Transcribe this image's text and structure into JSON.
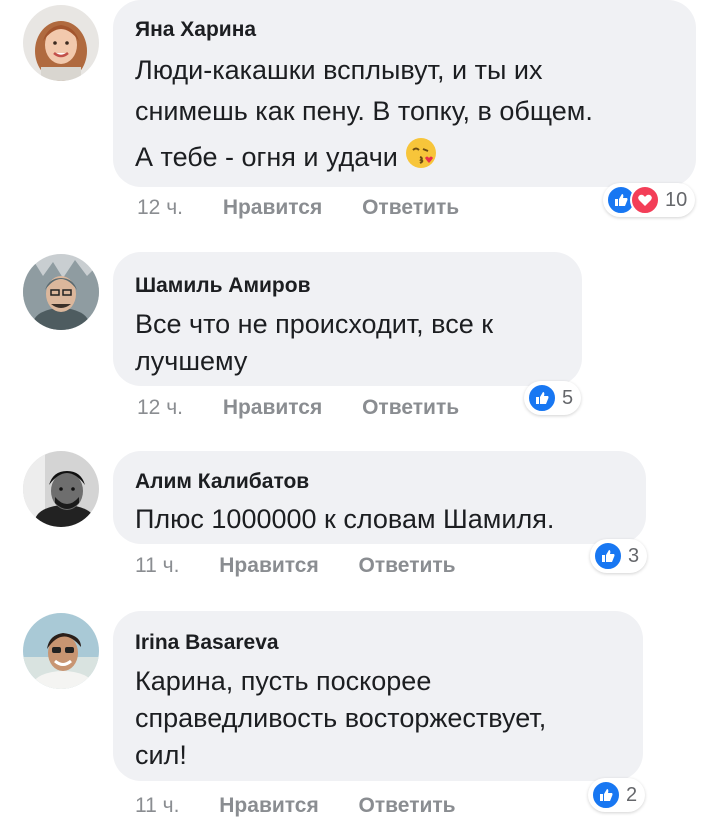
{
  "comments": [
    {
      "author": "Яна Харина",
      "lines": [
        "Люди-какашки всплывут, и ты их",
        "снимешь как пену. В топку, в общем.",
        "А тебе - огня и удачи"
      ],
      "time": "12 ч.",
      "like_label": "Нравится",
      "reply_label": "Ответить",
      "reaction_count": "10"
    },
    {
      "author": "Шамиль Амиров",
      "lines": [
        "Все что не происходит, все к",
        "лучшему"
      ],
      "time": "12 ч.",
      "like_label": "Нравится",
      "reply_label": "Ответить",
      "reaction_count": "5"
    },
    {
      "author": "Алим Калибатов",
      "lines": [
        "Плюс 1000000 к словам Шамиля."
      ],
      "time": "11 ч.",
      "like_label": "Нравится",
      "reply_label": "Ответить",
      "reaction_count": "3"
    },
    {
      "author": "Irina Basareva",
      "lines": [
        "Карина, пусть поскорее",
        "справедливость восторжествует,",
        "сил!"
      ],
      "time": "11 ч.",
      "like_label": "Нравится",
      "reply_label": "Ответить",
      "reaction_count": "2"
    }
  ],
  "colors": {
    "bubble": "#f0f1f4",
    "like_blue": "#1877f2",
    "love_red": "#f33e58",
    "meta_gray": "#8a8d91"
  },
  "icons": [
    "like-reaction-icon",
    "love-reaction-icon",
    "kiss-emoji-icon"
  ]
}
